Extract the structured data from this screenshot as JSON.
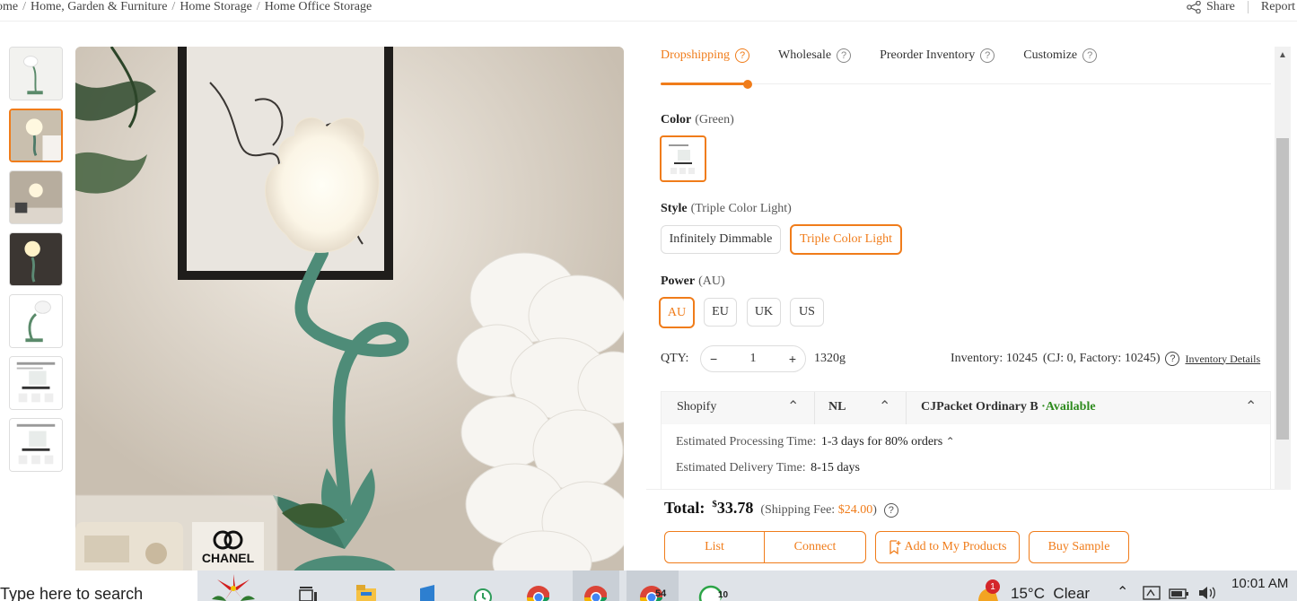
{
  "breadcrumb": {
    "items": [
      "ome",
      "Home, Garden & Furniture",
      "Home Storage",
      "Home Office Storage"
    ]
  },
  "top_actions": {
    "share_label": "Share",
    "report_label": "Report"
  },
  "tabs": [
    {
      "label": "Dropshipping",
      "active": true
    },
    {
      "label": "Wholesale",
      "active": false
    },
    {
      "label": "Preorder Inventory",
      "active": false
    },
    {
      "label": "Customize",
      "active": false
    }
  ],
  "color": {
    "label": "Color",
    "selected": "(Green)"
  },
  "style": {
    "label": "Style",
    "selected": "(Triple Color Light)",
    "options": [
      "Infinitely Dimmable",
      "Triple Color Light"
    ]
  },
  "power": {
    "label": "Power",
    "selected": "(AU)",
    "options": [
      "AU",
      "EU",
      "UK",
      "US"
    ]
  },
  "qty": {
    "label": "QTY:",
    "value": "1",
    "weight": "1320g",
    "inventory": "Inventory: 10245",
    "inventory_detail": "(CJ: 0, Factory: 10245)",
    "inventory_link": "Inventory Details"
  },
  "shipping": {
    "platform": "Shopify",
    "country": "NL",
    "method": "CJPacket Ordinary B",
    "availability": "·Available",
    "processing_label": "Estimated Processing Time:",
    "processing_value": "1-3 days for 80% orders",
    "delivery_label": "Estimated Delivery Time:",
    "delivery_value": "8-15 days"
  },
  "total": {
    "label": "Total:",
    "currency": "$",
    "amount": "33.78",
    "shipping_fee_prefix": "(Shipping Fee:",
    "shipping_fee": "$24.00",
    "shipping_fee_suffix": ")"
  },
  "buttons": {
    "list": "List",
    "connect": "Connect",
    "add_to_products": "Add to My Products",
    "buy_sample": "Buy Sample"
  },
  "image_text": {
    "brand": "CHANEL"
  },
  "taskbar": {
    "search_placeholder": "Type here to search",
    "weather": "15°C  Clear",
    "time": "10:01 AM",
    "notification_count": "1",
    "badge_54": "54",
    "badge_10": "10"
  },
  "colors": {
    "accent": "#f07c1a",
    "available": "#2e8b1e"
  }
}
